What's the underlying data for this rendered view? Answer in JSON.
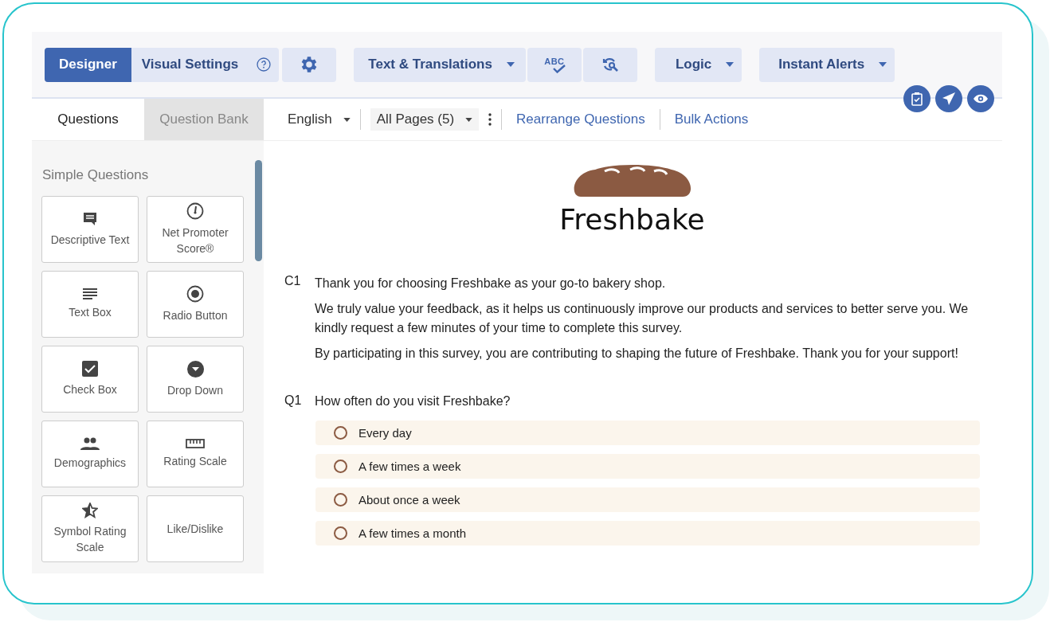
{
  "toolbar": {
    "mode_tabs": [
      {
        "label": "Designer",
        "selected": true
      },
      {
        "label": "Visual Settings",
        "selected": false
      }
    ],
    "dropdowns": [
      {
        "label": "Text & Translations"
      },
      {
        "label": "Logic"
      },
      {
        "label": "Instant Alerts"
      }
    ],
    "spellcheck_label": "ABC"
  },
  "panel_tabs": [
    {
      "label": "Questions",
      "selected": true
    },
    {
      "label": "Question Bank",
      "selected": false
    }
  ],
  "filters": {
    "language": "English",
    "pages": "All Pages (5)"
  },
  "links": [
    "Rearrange Questions",
    "Bulk Actions"
  ],
  "sidebar": {
    "section": "Simple Questions",
    "items": [
      {
        "label": "Descriptive Text"
      },
      {
        "label": "Net Promoter Score®"
      },
      {
        "label": "Text Box"
      },
      {
        "label": "Radio Button"
      },
      {
        "label": "Check Box"
      },
      {
        "label": "Drop Down"
      },
      {
        "label": "Demographics"
      },
      {
        "label": "Rating Scale"
      },
      {
        "label": "Symbol Rating Scale"
      },
      {
        "label": "Like/Dislike"
      }
    ]
  },
  "survey": {
    "logo_text": "Freshbake",
    "intro": {
      "number": "C1",
      "paragraphs": [
        "Thank you for choosing Freshbake as your go-to bakery shop.",
        "We truly value your feedback, as it helps us continuously improve our products and services to better serve you.  We kindly request a few minutes of your time to complete this survey.",
        "By participating in this survey, you are contributing to shaping the future of Freshbake. Thank you for your support!"
      ]
    },
    "question": {
      "number": "Q1",
      "text": "How often do you visit Freshbake?",
      "options": [
        {
          "label": "Every day",
          "selected": false
        },
        {
          "label": "A few times a week",
          "selected": false
        },
        {
          "label": "About once a week",
          "selected": false
        },
        {
          "label": "A few times a month",
          "selected": false
        }
      ]
    }
  }
}
